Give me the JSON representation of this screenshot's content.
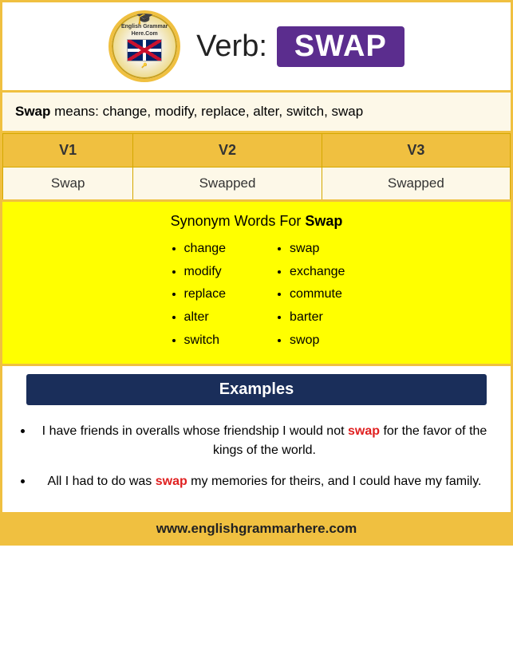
{
  "header": {
    "verb_label": "Verb:",
    "word": "SWAP",
    "logo": {
      "line1": "English Grammar Here.Com",
      "hat": "🎓"
    }
  },
  "means": {
    "bold": "Swap",
    "text": " means: change, modify, replace, alter, switch, swap"
  },
  "table": {
    "headers": [
      "V1",
      "V2",
      "V3"
    ],
    "row": [
      "Swap",
      "Swapped",
      "Swapped"
    ]
  },
  "synonym": {
    "title_normal": "Synonym Words For ",
    "title_bold": "Swap",
    "col1": [
      "change",
      "modify",
      "replace",
      "alter",
      "switch"
    ],
    "col2": [
      "swap",
      "exchange",
      "commute",
      "barter",
      "swop"
    ]
  },
  "examples_header": "Examples",
  "examples": [
    {
      "before": "I have friends in overalls whose friendship I would not ",
      "highlight": "swap",
      "after": " for the favor of the kings of the world."
    },
    {
      "before": "All I had to do was ",
      "highlight": "swap",
      "after": " my memories for theirs, and I could have my family."
    }
  ],
  "footer": "www.englishgrammarhere.com"
}
